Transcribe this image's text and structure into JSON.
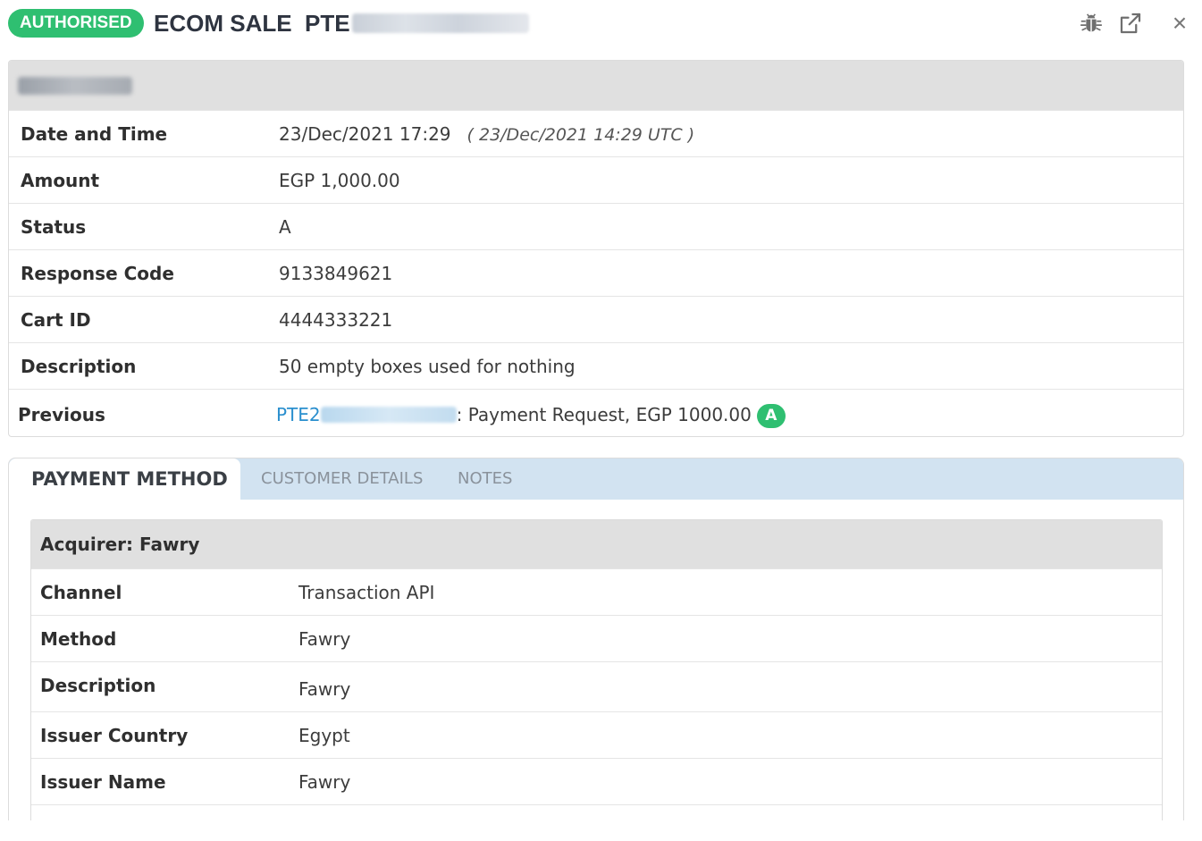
{
  "header": {
    "status_badge": "AUTHORISED",
    "title": "ECOM SALE  PTE",
    "icons": [
      "bug-icon",
      "share-icon",
      "close-icon"
    ],
    "close_glyph": "×"
  },
  "details": {
    "rows": [
      {
        "label": "Date and Time",
        "value": "23/Dec/2021 17:29",
        "extra": "( 23/Dec/2021 14:29 UTC )"
      },
      {
        "label": "Amount",
        "value": "EGP 1,000.00"
      },
      {
        "label": "Status",
        "value": "A"
      },
      {
        "label": "Response Code",
        "value": "9133849621"
      },
      {
        "label": "Cart ID",
        "value": "4444333221"
      },
      {
        "label": "Description",
        "value": "50 empty boxes used for nothing"
      }
    ],
    "previous": {
      "label": "Previous",
      "link_prefix": "PTE2",
      "text": ": Payment Request, EGP 1000.00",
      "badge": "A"
    }
  },
  "tabs": [
    {
      "label": "PAYMENT METHOD",
      "active": true
    },
    {
      "label": "CUSTOMER DETAILS",
      "active": false
    },
    {
      "label": "NOTES",
      "active": false
    }
  ],
  "payment_method": {
    "title": "Acquirer: Fawry",
    "rows": [
      {
        "label": "Channel",
        "value": "Transaction API"
      },
      {
        "label": "Method",
        "value": "Fawry"
      },
      {
        "label": "Description",
        "value": "Fawry"
      },
      {
        "label": "Issuer Country",
        "value": "Egypt"
      },
      {
        "label": "Issuer Name",
        "value": "Fawry"
      }
    ]
  },
  "colors": {
    "badge_green": "#2fbf71",
    "link_blue": "#2a8fce",
    "tab_bar": "#d2e3f1",
    "section_header_gray": "#e0e0e0"
  }
}
